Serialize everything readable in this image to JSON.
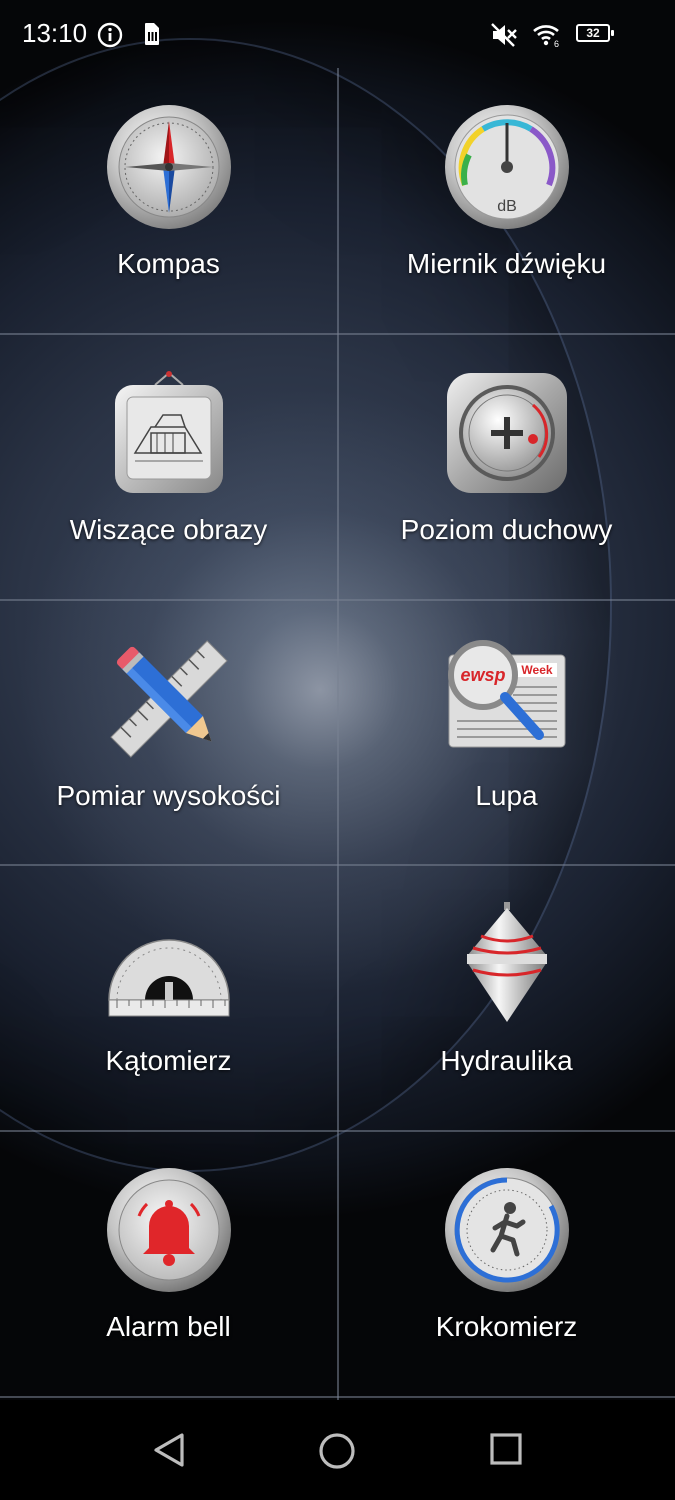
{
  "status_bar": {
    "time": "13:10",
    "battery": "32",
    "icons": [
      "info-icon",
      "sim-icon",
      "mute-icon",
      "wifi-icon",
      "battery-icon"
    ]
  },
  "tiles": [
    {
      "label": "Kompas",
      "icon": "compass-icon"
    },
    {
      "label": "Miernik dźwięku",
      "icon": "sound-meter-icon",
      "icon_text": "dB"
    },
    {
      "label": "Wiszące obrazy",
      "icon": "hanging-picture-icon"
    },
    {
      "label": "Poziom duchowy",
      "icon": "spirit-level-icon"
    },
    {
      "label": "Pomiar wysokości",
      "icon": "ruler-pencil-icon"
    },
    {
      "label": "Lupa",
      "icon": "magnifier-icon",
      "icon_text_a": "ewsp",
      "icon_text_b": "Week"
    },
    {
      "label": "Kątomierz",
      "icon": "protractor-icon"
    },
    {
      "label": "Hydraulika",
      "icon": "plumb-bob-icon"
    },
    {
      "label": "Alarm bell",
      "icon": "alarm-bell-icon"
    },
    {
      "label": "Krokomierz",
      "icon": "pedometer-icon"
    }
  ],
  "nav": {
    "buttons": [
      "back-icon",
      "home-icon",
      "recents-icon"
    ]
  },
  "colors": {
    "accent_red": "#d8262a",
    "accent_blue": "#2d6fd6",
    "metal": "#c8c8c8"
  }
}
